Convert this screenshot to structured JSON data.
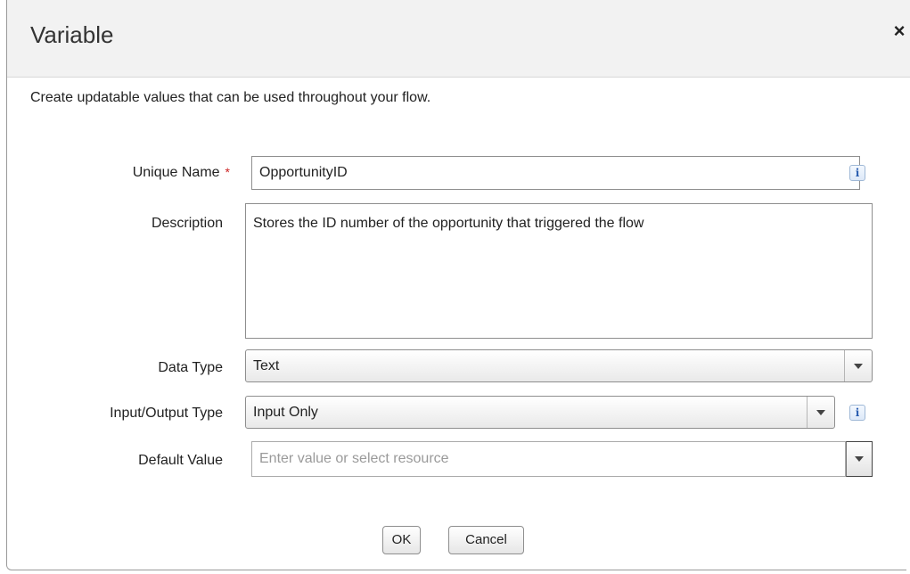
{
  "dialog": {
    "title": "Variable",
    "close_label": "×",
    "intro": "Create updatable values that can be used throughout your flow."
  },
  "form": {
    "unique_name": {
      "label": "Unique Name",
      "required_mark": "*",
      "value": "OpportunityID",
      "info_label": "i"
    },
    "description": {
      "label": "Description",
      "value": "Stores the ID number of the opportunity that triggered the flow"
    },
    "data_type": {
      "label": "Data Type",
      "value": "Text"
    },
    "io_type": {
      "label": "Input/Output Type",
      "value": "Input Only",
      "info_label": "i"
    },
    "default_value": {
      "label": "Default Value",
      "placeholder": "Enter value or select resource"
    }
  },
  "buttons": {
    "ok": "OK",
    "cancel": "Cancel"
  },
  "colors": {
    "required": "#cc2222",
    "info": "#2a5db0",
    "header_bg": "#f2f2f2"
  }
}
